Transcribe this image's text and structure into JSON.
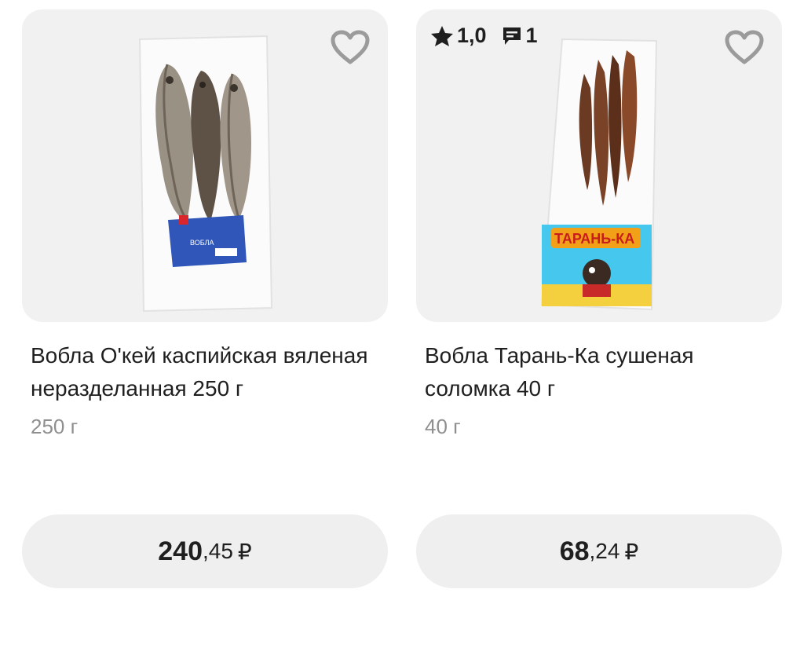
{
  "products": [
    {
      "title": "Вобла О'кей каспийская вяленая неразделанная 250 г",
      "weight": "250 г",
      "price_main": "240",
      "price_cents": ",45",
      "currency": "₽",
      "favorite_icon": "heart-outline-icon",
      "package_label": "ВОБЛА"
    },
    {
      "title": "Вобла Тарань-Ка сушеная соломка 40 г",
      "weight": "40 г",
      "price_main": "68",
      "price_cents": ",24",
      "currency": "₽",
      "rating": "1,0",
      "reviews": "1",
      "favorite_icon": "heart-outline-icon",
      "package_label": "ТАРАНЬ-КА"
    }
  ]
}
